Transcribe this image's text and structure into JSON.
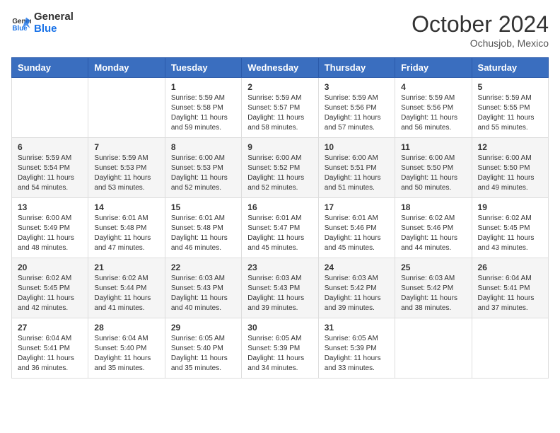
{
  "logo": {
    "line1": "General",
    "line2": "Blue"
  },
  "title": "October 2024",
  "location": "Ochusjob, Mexico",
  "days_of_week": [
    "Sunday",
    "Monday",
    "Tuesday",
    "Wednesday",
    "Thursday",
    "Friday",
    "Saturday"
  ],
  "weeks": [
    [
      {
        "day": "",
        "info": ""
      },
      {
        "day": "",
        "info": ""
      },
      {
        "day": "1",
        "info": "Sunrise: 5:59 AM\nSunset: 5:58 PM\nDaylight: 11 hours and 59 minutes."
      },
      {
        "day": "2",
        "info": "Sunrise: 5:59 AM\nSunset: 5:57 PM\nDaylight: 11 hours and 58 minutes."
      },
      {
        "day": "3",
        "info": "Sunrise: 5:59 AM\nSunset: 5:56 PM\nDaylight: 11 hours and 57 minutes."
      },
      {
        "day": "4",
        "info": "Sunrise: 5:59 AM\nSunset: 5:56 PM\nDaylight: 11 hours and 56 minutes."
      },
      {
        "day": "5",
        "info": "Sunrise: 5:59 AM\nSunset: 5:55 PM\nDaylight: 11 hours and 55 minutes."
      }
    ],
    [
      {
        "day": "6",
        "info": "Sunrise: 5:59 AM\nSunset: 5:54 PM\nDaylight: 11 hours and 54 minutes."
      },
      {
        "day": "7",
        "info": "Sunrise: 5:59 AM\nSunset: 5:53 PM\nDaylight: 11 hours and 53 minutes."
      },
      {
        "day": "8",
        "info": "Sunrise: 6:00 AM\nSunset: 5:53 PM\nDaylight: 11 hours and 52 minutes."
      },
      {
        "day": "9",
        "info": "Sunrise: 6:00 AM\nSunset: 5:52 PM\nDaylight: 11 hours and 52 minutes."
      },
      {
        "day": "10",
        "info": "Sunrise: 6:00 AM\nSunset: 5:51 PM\nDaylight: 11 hours and 51 minutes."
      },
      {
        "day": "11",
        "info": "Sunrise: 6:00 AM\nSunset: 5:50 PM\nDaylight: 11 hours and 50 minutes."
      },
      {
        "day": "12",
        "info": "Sunrise: 6:00 AM\nSunset: 5:50 PM\nDaylight: 11 hours and 49 minutes."
      }
    ],
    [
      {
        "day": "13",
        "info": "Sunrise: 6:00 AM\nSunset: 5:49 PM\nDaylight: 11 hours and 48 minutes."
      },
      {
        "day": "14",
        "info": "Sunrise: 6:01 AM\nSunset: 5:48 PM\nDaylight: 11 hours and 47 minutes."
      },
      {
        "day": "15",
        "info": "Sunrise: 6:01 AM\nSunset: 5:48 PM\nDaylight: 11 hours and 46 minutes."
      },
      {
        "day": "16",
        "info": "Sunrise: 6:01 AM\nSunset: 5:47 PM\nDaylight: 11 hours and 45 minutes."
      },
      {
        "day": "17",
        "info": "Sunrise: 6:01 AM\nSunset: 5:46 PM\nDaylight: 11 hours and 45 minutes."
      },
      {
        "day": "18",
        "info": "Sunrise: 6:02 AM\nSunset: 5:46 PM\nDaylight: 11 hours and 44 minutes."
      },
      {
        "day": "19",
        "info": "Sunrise: 6:02 AM\nSunset: 5:45 PM\nDaylight: 11 hours and 43 minutes."
      }
    ],
    [
      {
        "day": "20",
        "info": "Sunrise: 6:02 AM\nSunset: 5:45 PM\nDaylight: 11 hours and 42 minutes."
      },
      {
        "day": "21",
        "info": "Sunrise: 6:02 AM\nSunset: 5:44 PM\nDaylight: 11 hours and 41 minutes."
      },
      {
        "day": "22",
        "info": "Sunrise: 6:03 AM\nSunset: 5:43 PM\nDaylight: 11 hours and 40 minutes."
      },
      {
        "day": "23",
        "info": "Sunrise: 6:03 AM\nSunset: 5:43 PM\nDaylight: 11 hours and 39 minutes."
      },
      {
        "day": "24",
        "info": "Sunrise: 6:03 AM\nSunset: 5:42 PM\nDaylight: 11 hours and 39 minutes."
      },
      {
        "day": "25",
        "info": "Sunrise: 6:03 AM\nSunset: 5:42 PM\nDaylight: 11 hours and 38 minutes."
      },
      {
        "day": "26",
        "info": "Sunrise: 6:04 AM\nSunset: 5:41 PM\nDaylight: 11 hours and 37 minutes."
      }
    ],
    [
      {
        "day": "27",
        "info": "Sunrise: 6:04 AM\nSunset: 5:41 PM\nDaylight: 11 hours and 36 minutes."
      },
      {
        "day": "28",
        "info": "Sunrise: 6:04 AM\nSunset: 5:40 PM\nDaylight: 11 hours and 35 minutes."
      },
      {
        "day": "29",
        "info": "Sunrise: 6:05 AM\nSunset: 5:40 PM\nDaylight: 11 hours and 35 minutes."
      },
      {
        "day": "30",
        "info": "Sunrise: 6:05 AM\nSunset: 5:39 PM\nDaylight: 11 hours and 34 minutes."
      },
      {
        "day": "31",
        "info": "Sunrise: 6:05 AM\nSunset: 5:39 PM\nDaylight: 11 hours and 33 minutes."
      },
      {
        "day": "",
        "info": ""
      },
      {
        "day": "",
        "info": ""
      }
    ]
  ]
}
